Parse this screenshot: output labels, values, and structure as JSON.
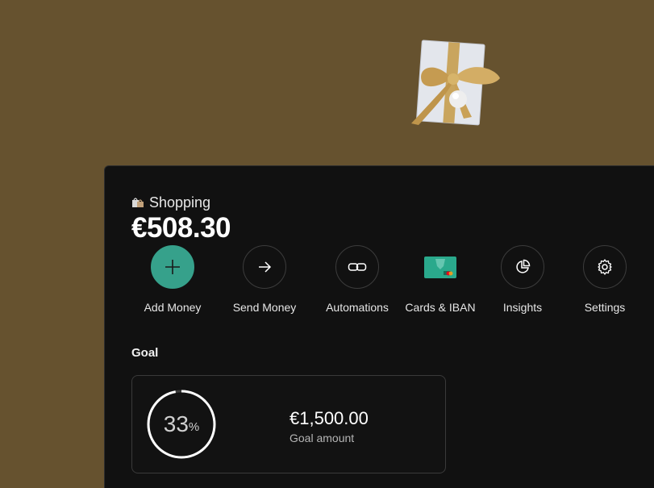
{
  "colors": {
    "background": "#66522f",
    "panel": "#111111",
    "accent": "#36a18b",
    "text_primary": "#ffffff",
    "text_secondary": "#b5b5b5"
  },
  "space": {
    "emoji_icon": "shopping-bags-icon",
    "name": "Shopping",
    "balance": "€508.30"
  },
  "actions": [
    {
      "label": "Add Money",
      "icon": "plus-icon"
    },
    {
      "label": "Send Money",
      "icon": "arrow-right-icon"
    },
    {
      "label": "Automations",
      "icon": "link-icon"
    },
    {
      "label": "Cards & IBAN",
      "icon": "card-icon"
    },
    {
      "label": "Insights",
      "icon": "pie-chart-icon"
    },
    {
      "label": "Settings",
      "icon": "gear-icon"
    }
  ],
  "goal": {
    "title": "Goal",
    "progress_value": "33",
    "progress_unit": "%",
    "progress_fraction": 0.33,
    "amount": "€1,500.00",
    "amount_label": "Goal amount"
  }
}
